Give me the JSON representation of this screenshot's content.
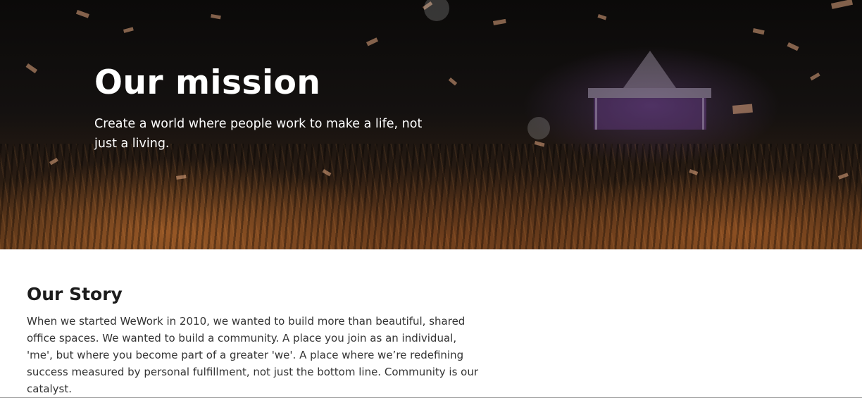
{
  "hero": {
    "title": "Our mission",
    "subtitle": "Create a world where people work to make a life, not just a living."
  },
  "story": {
    "title": "Our Story",
    "body": "When we started WeWork in 2010, we wanted to build more than beautiful, shared office spaces. We wanted to build a community. A place you join as an individual, 'me', but where you become part of a greater 'we'. A place where we’re redefining success measured by personal fulfillment, not just the bottom line. Community is our catalyst."
  },
  "colors": {
    "hero_text": "#ffffff",
    "heading_text": "#1c1c1c",
    "body_text": "#333333",
    "divider": "#9a9a9a"
  }
}
